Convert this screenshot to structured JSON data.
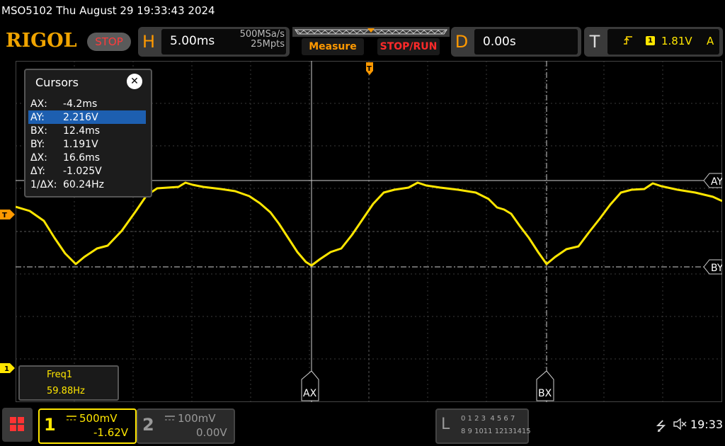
{
  "title_line": "MSO5102  Thu August 29 19:33:43 2024",
  "logo": "RIGOL",
  "run_state": "STOP",
  "horizontal": {
    "letter": "H",
    "scale": "5.00ms",
    "sample_rate": "500MSa/s",
    "memory_depth": "25Mpts"
  },
  "buttons": {
    "measure": "Measure",
    "stop_run": "STOP/RUN"
  },
  "delay": {
    "letter": "D",
    "value": "0.00s"
  },
  "trigger": {
    "letter": "T",
    "edge_icon": "rising-edge-icon",
    "channel": "1",
    "level": "1.81V",
    "mode": "A"
  },
  "cursors": {
    "title": "Cursors",
    "rows": [
      {
        "key": "AX:",
        "value": "-4.2ms"
      },
      {
        "key": "AY:",
        "value": "2.216V",
        "highlighted": true
      },
      {
        "key": "BX:",
        "value": "12.4ms"
      },
      {
        "key": "BY:",
        "value": "1.191V"
      },
      {
        "key": "ΔX:",
        "value": "16.6ms"
      },
      {
        "key": "ΔY:",
        "value": "-1.025V"
      },
      {
        "key": "1/ΔX:",
        "value": "60.24Hz"
      }
    ]
  },
  "cursor_labels": {
    "ax": "AX",
    "bx": "BX",
    "ay": "AY",
    "by": "BY"
  },
  "markers": {
    "trigger_level": "T",
    "channel1_ground": "1",
    "trigger_position": "T"
  },
  "measurement": {
    "label": "Freq1",
    "value": "59.88Hz"
  },
  "channel1": {
    "number": "1",
    "scale": "500mV",
    "offset": "-1.62V"
  },
  "channel2": {
    "number": "2",
    "scale": "100mV",
    "offset": "0.00V"
  },
  "logic": {
    "letter": "L",
    "row1": "0 1 2 3  4 5 6 7",
    "row2": "8 9 1011 12131415"
  },
  "status": {
    "usb_icon": "usb-icon",
    "sound_icon": "muted-speaker-icon",
    "time": "19:33"
  },
  "colors": {
    "ch1": "#ffe600",
    "accent": "#ff9900",
    "stop": "#ff3b3b",
    "highlight": "#1d5fb0"
  }
}
